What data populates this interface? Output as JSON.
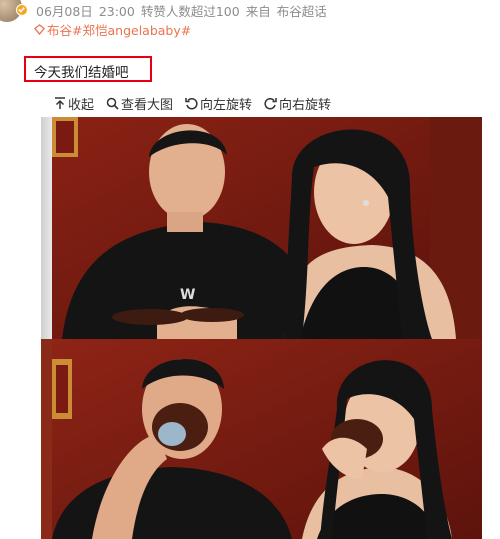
{
  "post": {
    "date": "06月08日",
    "time": "23:00",
    "reposts_text": "转赞人数超过100",
    "source_prefix": "来自",
    "source": "布谷超话",
    "topics": [
      "布谷",
      "#郑恺angelababy#"
    ],
    "text": "今天我们结婚吧"
  },
  "toolbar": {
    "items": [
      {
        "icon": "collapse-icon",
        "label": "收起"
      },
      {
        "icon": "zoom-icon",
        "label": "查看大图"
      },
      {
        "icon": "rotate-left-icon",
        "label": "向左旋转"
      },
      {
        "icon": "rotate-right-icon",
        "label": "向右旋转"
      }
    ]
  },
  "colors": {
    "highlight_border": "#e60012",
    "topic_link": "#eb7350",
    "meta_text": "#8c8c8c",
    "verify_badge": "#f5a623",
    "photo_background": "#7a1a12"
  }
}
